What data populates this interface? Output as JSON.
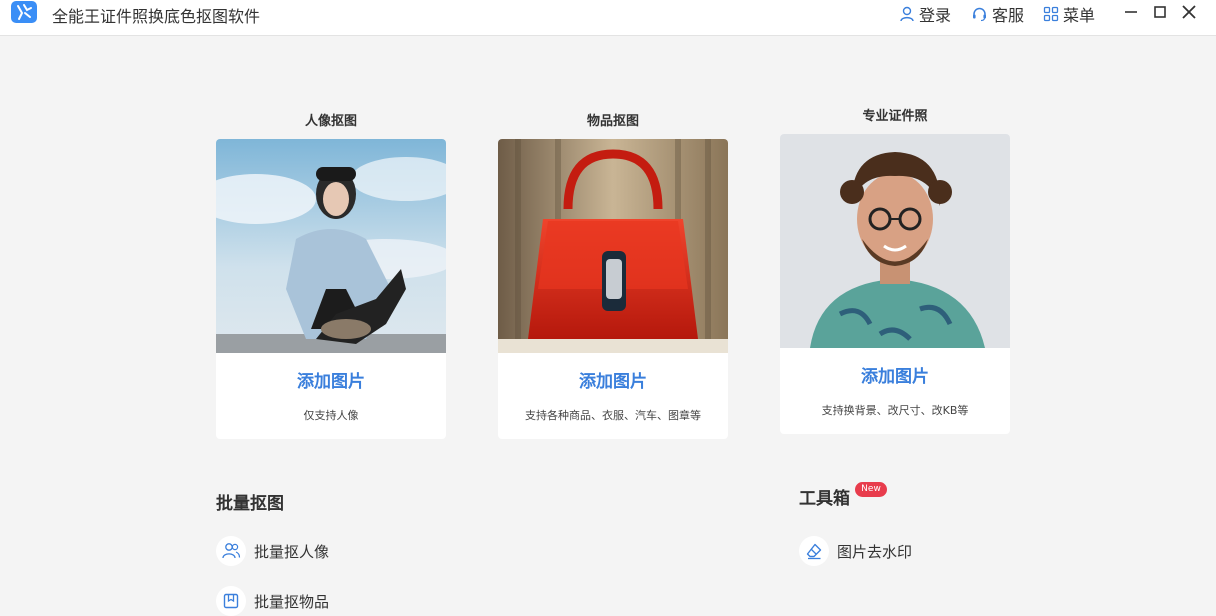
{
  "app": {
    "title": "全能王证件照换底色抠图软件"
  },
  "header": {
    "login_label": "登录",
    "service_label": "客服",
    "menu_label": "菜单"
  },
  "cards": [
    {
      "title": "人像抠图",
      "add_label": "添加图片",
      "desc": "仅支持人像"
    },
    {
      "title": "物品抠图",
      "add_label": "添加图片",
      "desc": "支持各种商品、衣服、汽车、图章等"
    },
    {
      "title": "专业证件照",
      "add_label": "添加图片",
      "desc": "支持换背景、改尺寸、改KB等"
    }
  ],
  "batch": {
    "title": "批量抠图",
    "items": [
      {
        "label": "批量抠人像"
      },
      {
        "label": "批量抠物品"
      }
    ]
  },
  "toolbox": {
    "title": "工具箱",
    "badge": "New",
    "items": [
      {
        "label": "图片去水印"
      }
    ]
  },
  "colors": {
    "accent": "#3a7fdc",
    "badge": "#e83c4c",
    "background": "#f4f4f4"
  }
}
